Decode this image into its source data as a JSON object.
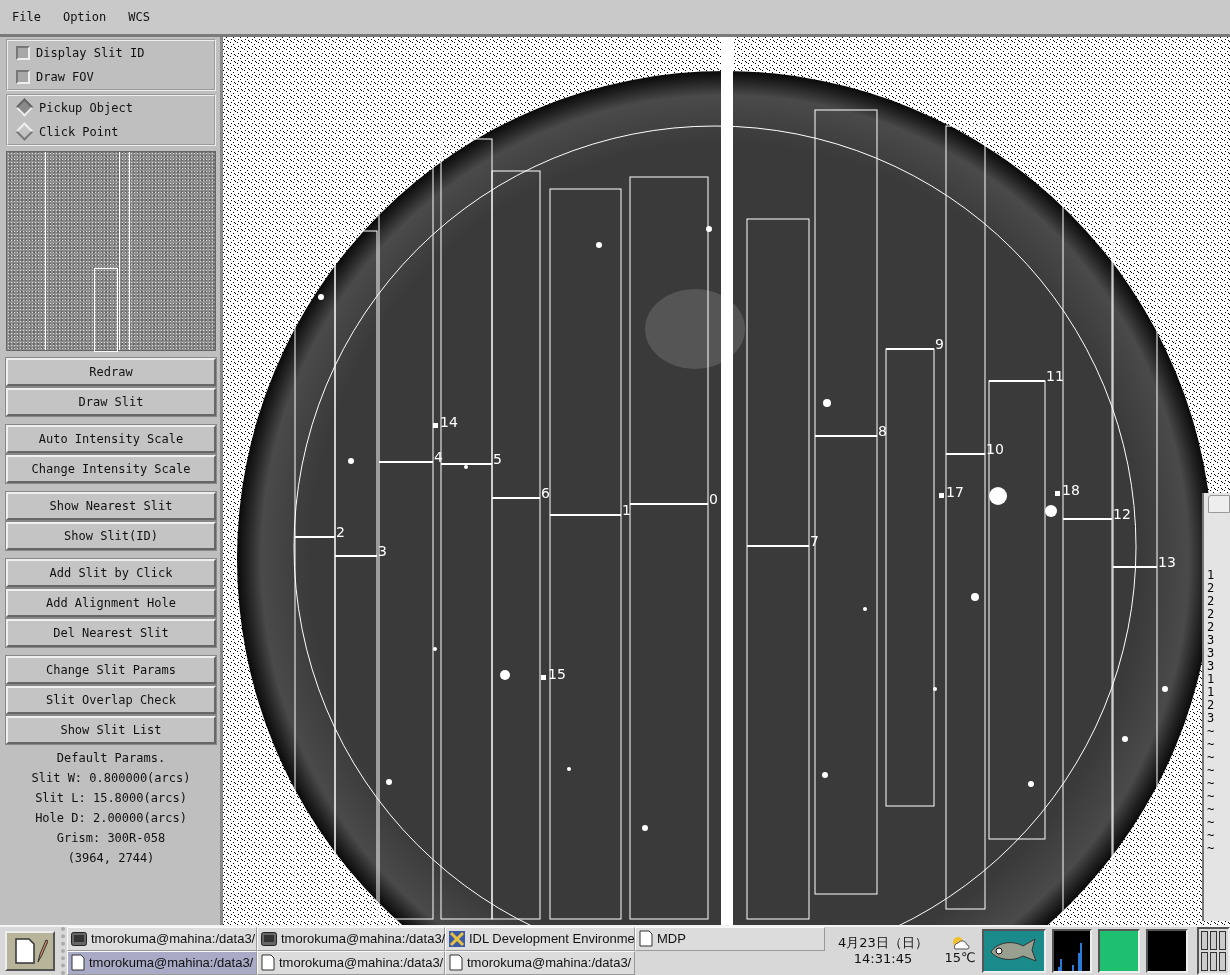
{
  "menu": [
    "File",
    "Option",
    "WCS"
  ],
  "display_options": [
    {
      "label": "Display Slit ID",
      "checked": false
    },
    {
      "label": "Draw FOV",
      "checked": false
    }
  ],
  "pick_modes": [
    {
      "label": "Pickup Object",
      "selected": true
    },
    {
      "label": "Click Point",
      "selected": false
    }
  ],
  "button_groups": [
    [
      "Redraw",
      "Draw Slit"
    ],
    [
      "Auto Intensity Scale",
      "Change Intensity Scale"
    ],
    [
      "Show Nearest Slit",
      "Show Slit(ID)"
    ],
    [
      "Add Slit by Click",
      "Add Alignment Hole",
      "Del Nearest Slit"
    ],
    [
      "Change Slit Params",
      "Slit Overlap Check",
      "Show Slit List"
    ]
  ],
  "default_params": [
    "Default Params.",
    "Slit W: 0.800000(arcs)",
    "Slit L: 15.8000(arcs)",
    "Hole D: 2.00000(arcs)",
    "Grism: 300R-058",
    "(3964, 2744)"
  ],
  "slits": [
    {
      "label": "2"
    },
    {
      "label": "3"
    },
    {
      "label": "4"
    },
    {
      "label": "5"
    },
    {
      "label": "6"
    },
    {
      "label": "1"
    },
    {
      "label": "0"
    },
    {
      "label": "7"
    },
    {
      "label": "8"
    },
    {
      "label": "9"
    },
    {
      "label": "10"
    },
    {
      "label": "11"
    },
    {
      "label": "12"
    },
    {
      "label": "13"
    }
  ],
  "holes": [
    {
      "label": "14"
    },
    {
      "label": "15"
    },
    {
      "label": "17"
    },
    {
      "label": "18"
    }
  ],
  "side_window": {
    "lines": [
      "1",
      "2",
      "2",
      "2",
      "2",
      "3",
      "3",
      "3",
      "1",
      "1",
      "2",
      "3",
      "~",
      "~",
      "~",
      "~",
      "~",
      "~",
      "~",
      "~",
      "~",
      "~"
    ]
  },
  "taskbar": {
    "tasks": [
      {
        "label": "tmorokuma@mahina:/data3/",
        "kind": "terminal",
        "selected": false
      },
      {
        "label": "tmorokuma@mahina:/data3/",
        "kind": "terminal",
        "selected": false
      },
      {
        "label": "IDL Development Environme",
        "kind": "app",
        "selected": false
      },
      {
        "label": "MDP",
        "kind": "document",
        "selected": false
      },
      {
        "label": "tmorokuma@mahina:/data3/",
        "kind": "document",
        "selected": true
      },
      {
        "label": "tmorokuma@mahina:/data3/",
        "kind": "document",
        "selected": false
      },
      {
        "label": "tmorokuma@mahina:/data3/",
        "kind": "document",
        "selected": false
      }
    ],
    "date": "4月23日（日）",
    "time": "14:31:45",
    "temperature": "15℃"
  }
}
